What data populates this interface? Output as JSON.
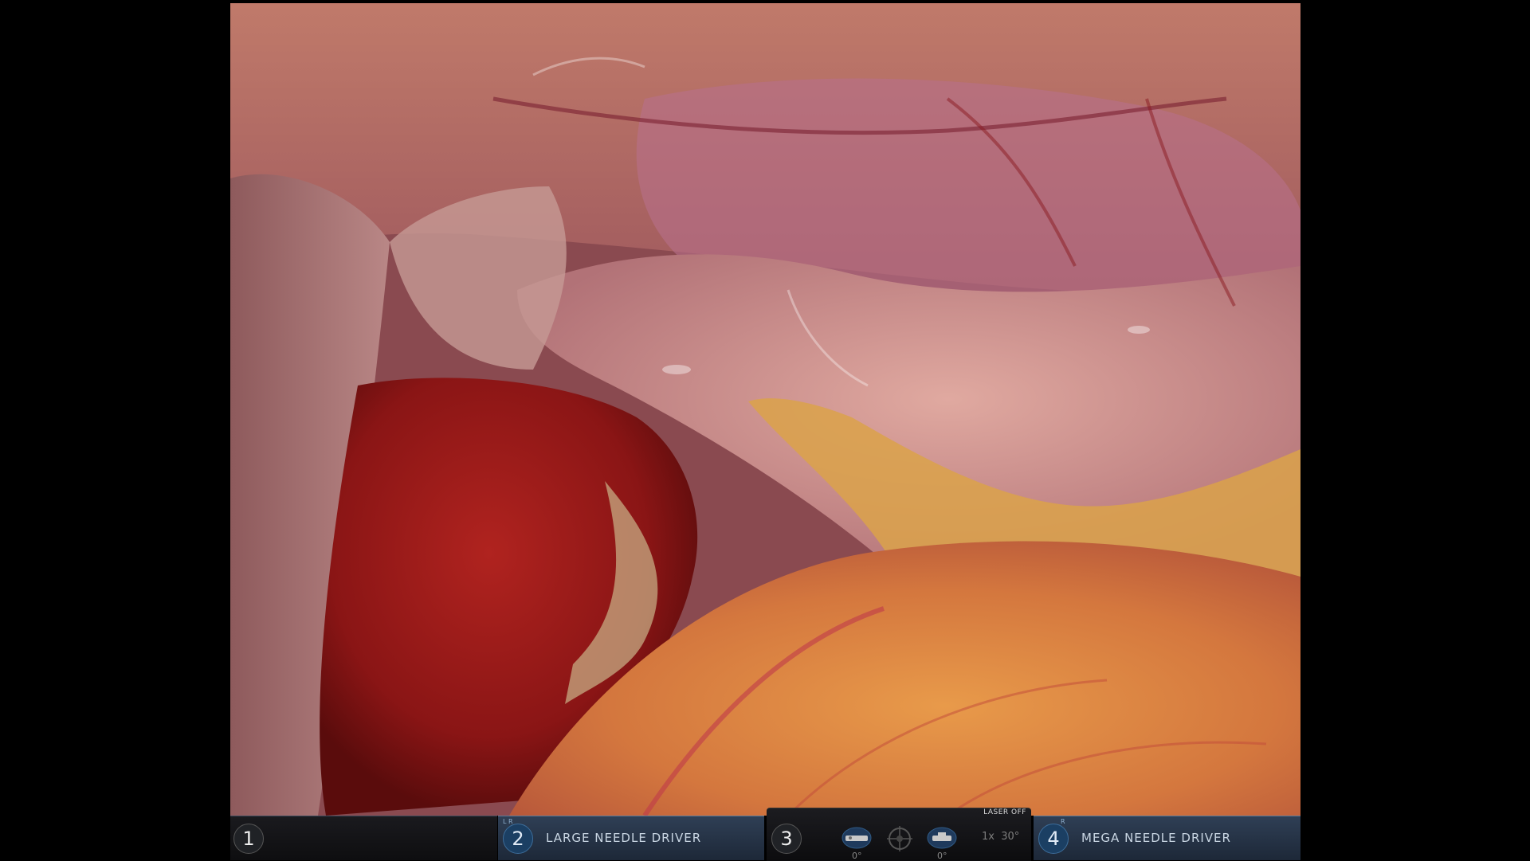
{
  "video_feed": {
    "description_icon": "endoscope-view"
  },
  "arms": [
    {
      "number": "1",
      "label": "",
      "lr": ""
    },
    {
      "number": "2",
      "label": "LARGE NEEDLE DRIVER",
      "lr": "L  R"
    },
    {
      "number": "3",
      "label": "",
      "lr": ""
    },
    {
      "number": "4",
      "label": "MEGA NEEDLE DRIVER",
      "lr": "R"
    }
  ],
  "camera": {
    "laser_status": "LASER OFF",
    "left_angle": "0°",
    "right_angle": "0°",
    "zoom": "1x",
    "scope_angle": "30°"
  }
}
